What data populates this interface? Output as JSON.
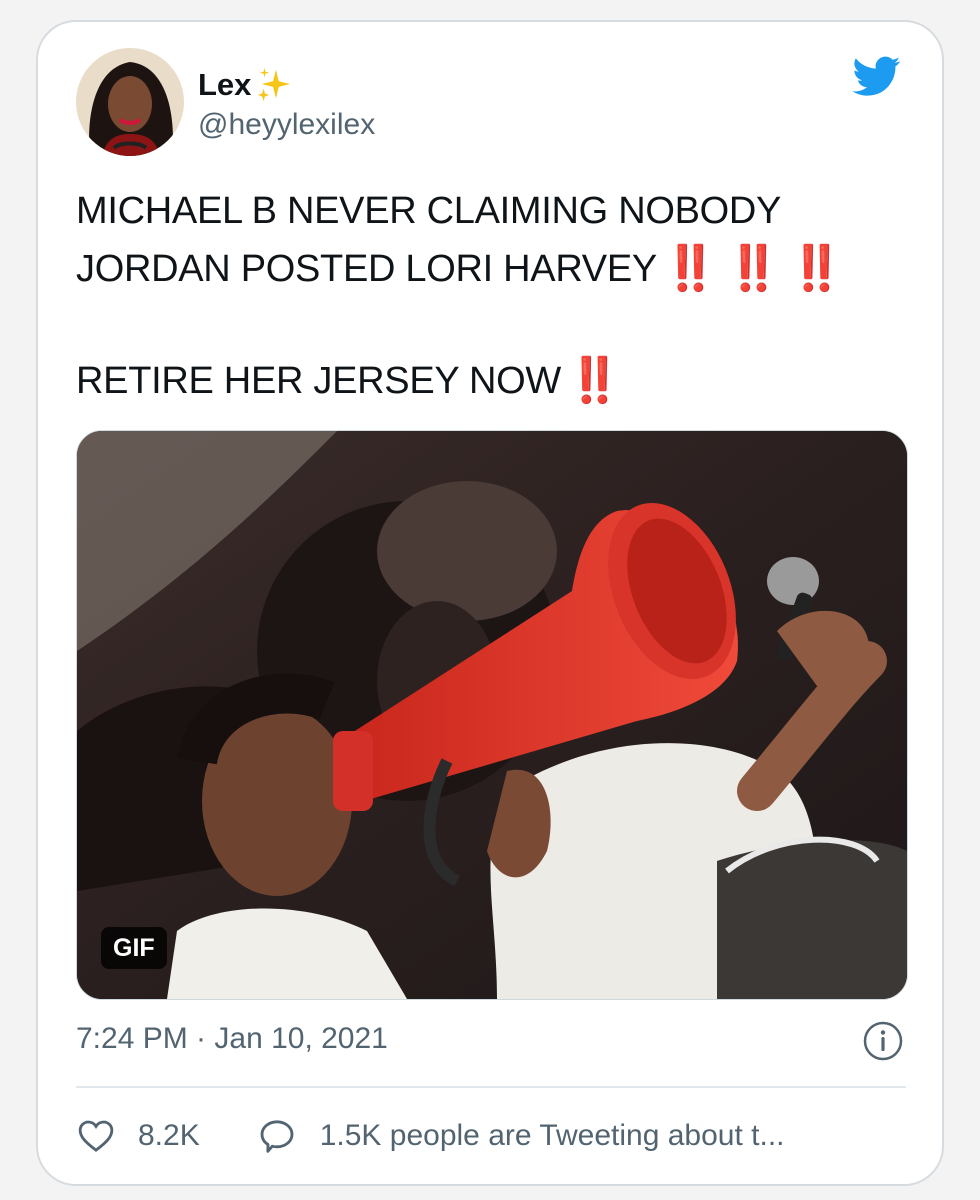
{
  "author": {
    "display_name": "Lex",
    "handle": "@heyylexilex",
    "name_emoji_icon": "sparkles-icon"
  },
  "brand_icon": "twitter-bird-icon",
  "tweet": {
    "line1": "MICHAEL B  NEVER CLAIMING NOBODY",
    "line2": "JORDAN POSTED LORI HARVEY",
    "line2_marks": "‼️ ‼️ ‼️",
    "line3": "RETIRE HER JERSEY NOW",
    "line3_marks": "‼️"
  },
  "media": {
    "badge": "GIF"
  },
  "meta": {
    "timestamp": "7:24 PM · Jan 10, 2021",
    "info_icon": "info-icon"
  },
  "actions": {
    "likes": "8.2K",
    "like_icon": "heart-icon",
    "reply_icon": "speech-bubble-icon",
    "conversation_text": "1.5K people are Tweeting about t..."
  },
  "colors": {
    "twitter_blue": "#1d9bf0",
    "exclamation_red": "#c0262d",
    "secondary_text": "#536471"
  }
}
